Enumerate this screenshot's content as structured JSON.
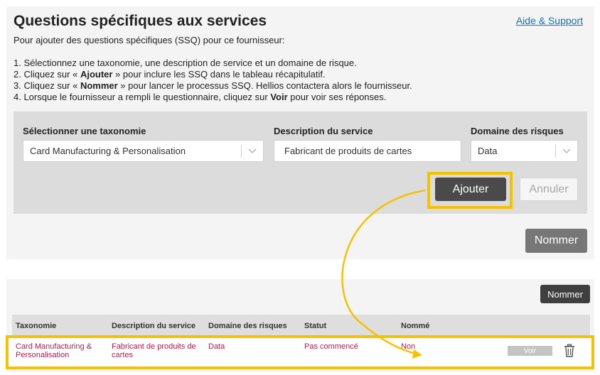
{
  "page": {
    "title": "Questions spécifiques aux services",
    "help_link": "Aide & Support",
    "intro": "Pour ajouter des questions spécifiques (SSQ) pour ce fournisseur:",
    "steps": [
      {
        "pre": "1. Sélectionnez une taxonomie, une description de service et un domaine de risque.",
        "bold": "",
        "post": ""
      },
      {
        "pre": "2. Cliquez sur « ",
        "bold": "Ajouter",
        "post": " » pour inclure les SSQ dans le tableau récapitulatif."
      },
      {
        "pre": "3. Cliquez sur « ",
        "bold": "Nommer",
        "post": " » pour lancer le processus SSQ. Hellios contactera alors le fournisseur."
      },
      {
        "pre": "4. Lorsque le fournisseur a rempli le questionnaire, cliquez sur ",
        "bold": "Voir",
        "post": " pour voir ses réponses."
      }
    ]
  },
  "form": {
    "taxonomy_label": "Sélectionner une taxonomie",
    "taxonomy_value": "Card Manufacturing & Personalisation",
    "service_label": "Description du service",
    "service_value": "Fabricant de produits de cartes",
    "risk_label": "Domaine des risques",
    "risk_value": "Data",
    "add_button": "Ajouter",
    "cancel_button": "Annuler",
    "nominate_button": "Nommer"
  },
  "table": {
    "nominate_button": "Nommer",
    "headers": {
      "taxonomy": "Taxonomie",
      "service": "Description du service",
      "risk": "Domaine des risques",
      "status": "Statut",
      "nominated": "Nommé"
    },
    "rows": [
      {
        "taxonomy_line1": "Card Manufacturing &",
        "taxonomy_line2": "Personalisation",
        "service_line1": "Fabricant de produits de",
        "service_line2": "cartes",
        "risk": "Data",
        "status": "Pas commencé",
        "nominated": "Non",
        "view_button": "Voir",
        "delete_icon": "trash-icon"
      }
    ]
  },
  "colors": {
    "highlight": "#f6c200",
    "link": "#1a6fb5",
    "row_text": "#b3204a",
    "primary_button": "#4a4a4a"
  }
}
